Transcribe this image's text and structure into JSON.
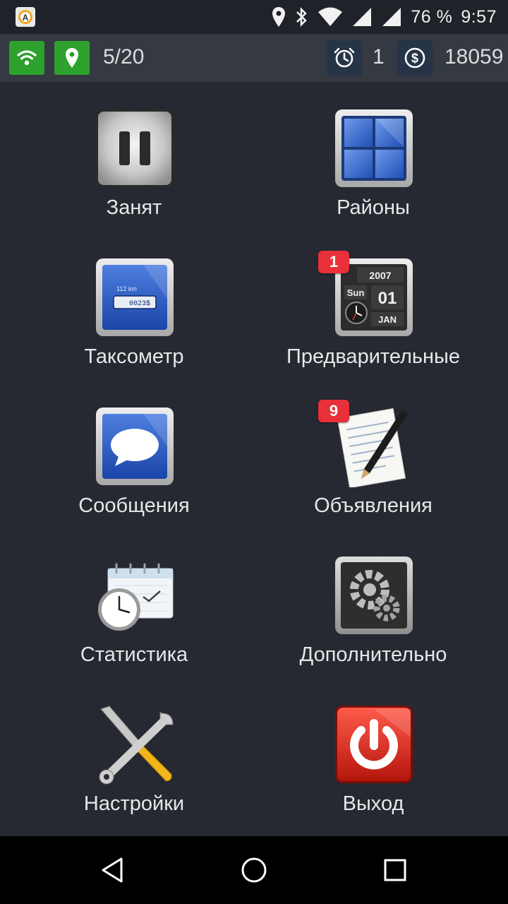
{
  "status_bar": {
    "battery_percent": "76 %",
    "time": "9:57",
    "icons": [
      "app-icon",
      "location-icon",
      "bluetooth-icon",
      "wifi-icon",
      "signal-icon",
      "signal-icon"
    ]
  },
  "toolbar": {
    "orders_count": "5/20",
    "alarm_count": "1",
    "balance": "18059",
    "colors": {
      "green": "#2ea12e",
      "dark_button": "#273448"
    }
  },
  "menu": {
    "items": [
      {
        "label": "Занят",
        "icon": "pause-icon"
      },
      {
        "label": "Районы",
        "icon": "districts-grid-icon"
      },
      {
        "label": "Таксометр",
        "icon": "taximeter-icon",
        "meter_km": "112 km",
        "meter_value": "0023$"
      },
      {
        "label": "Предварительные",
        "icon": "calendar-clock-icon",
        "badge": "1",
        "cal_year": "2007",
        "cal_day": "Sun",
        "cal_date": "01",
        "cal_month": "JAN"
      },
      {
        "label": "Сообщения",
        "icon": "message-bubble-icon"
      },
      {
        "label": "Объявления",
        "icon": "notepad-pen-icon",
        "badge": "9"
      },
      {
        "label": "Статистика",
        "icon": "statistics-clock-icon"
      },
      {
        "label": "Дополнительно",
        "icon": "gears-icon"
      },
      {
        "label": "Настройки",
        "icon": "tools-icon"
      },
      {
        "label": "Выход",
        "icon": "power-icon"
      }
    ]
  },
  "nav_bar": {
    "icons": [
      "back-icon",
      "home-icon",
      "recents-icon"
    ]
  }
}
